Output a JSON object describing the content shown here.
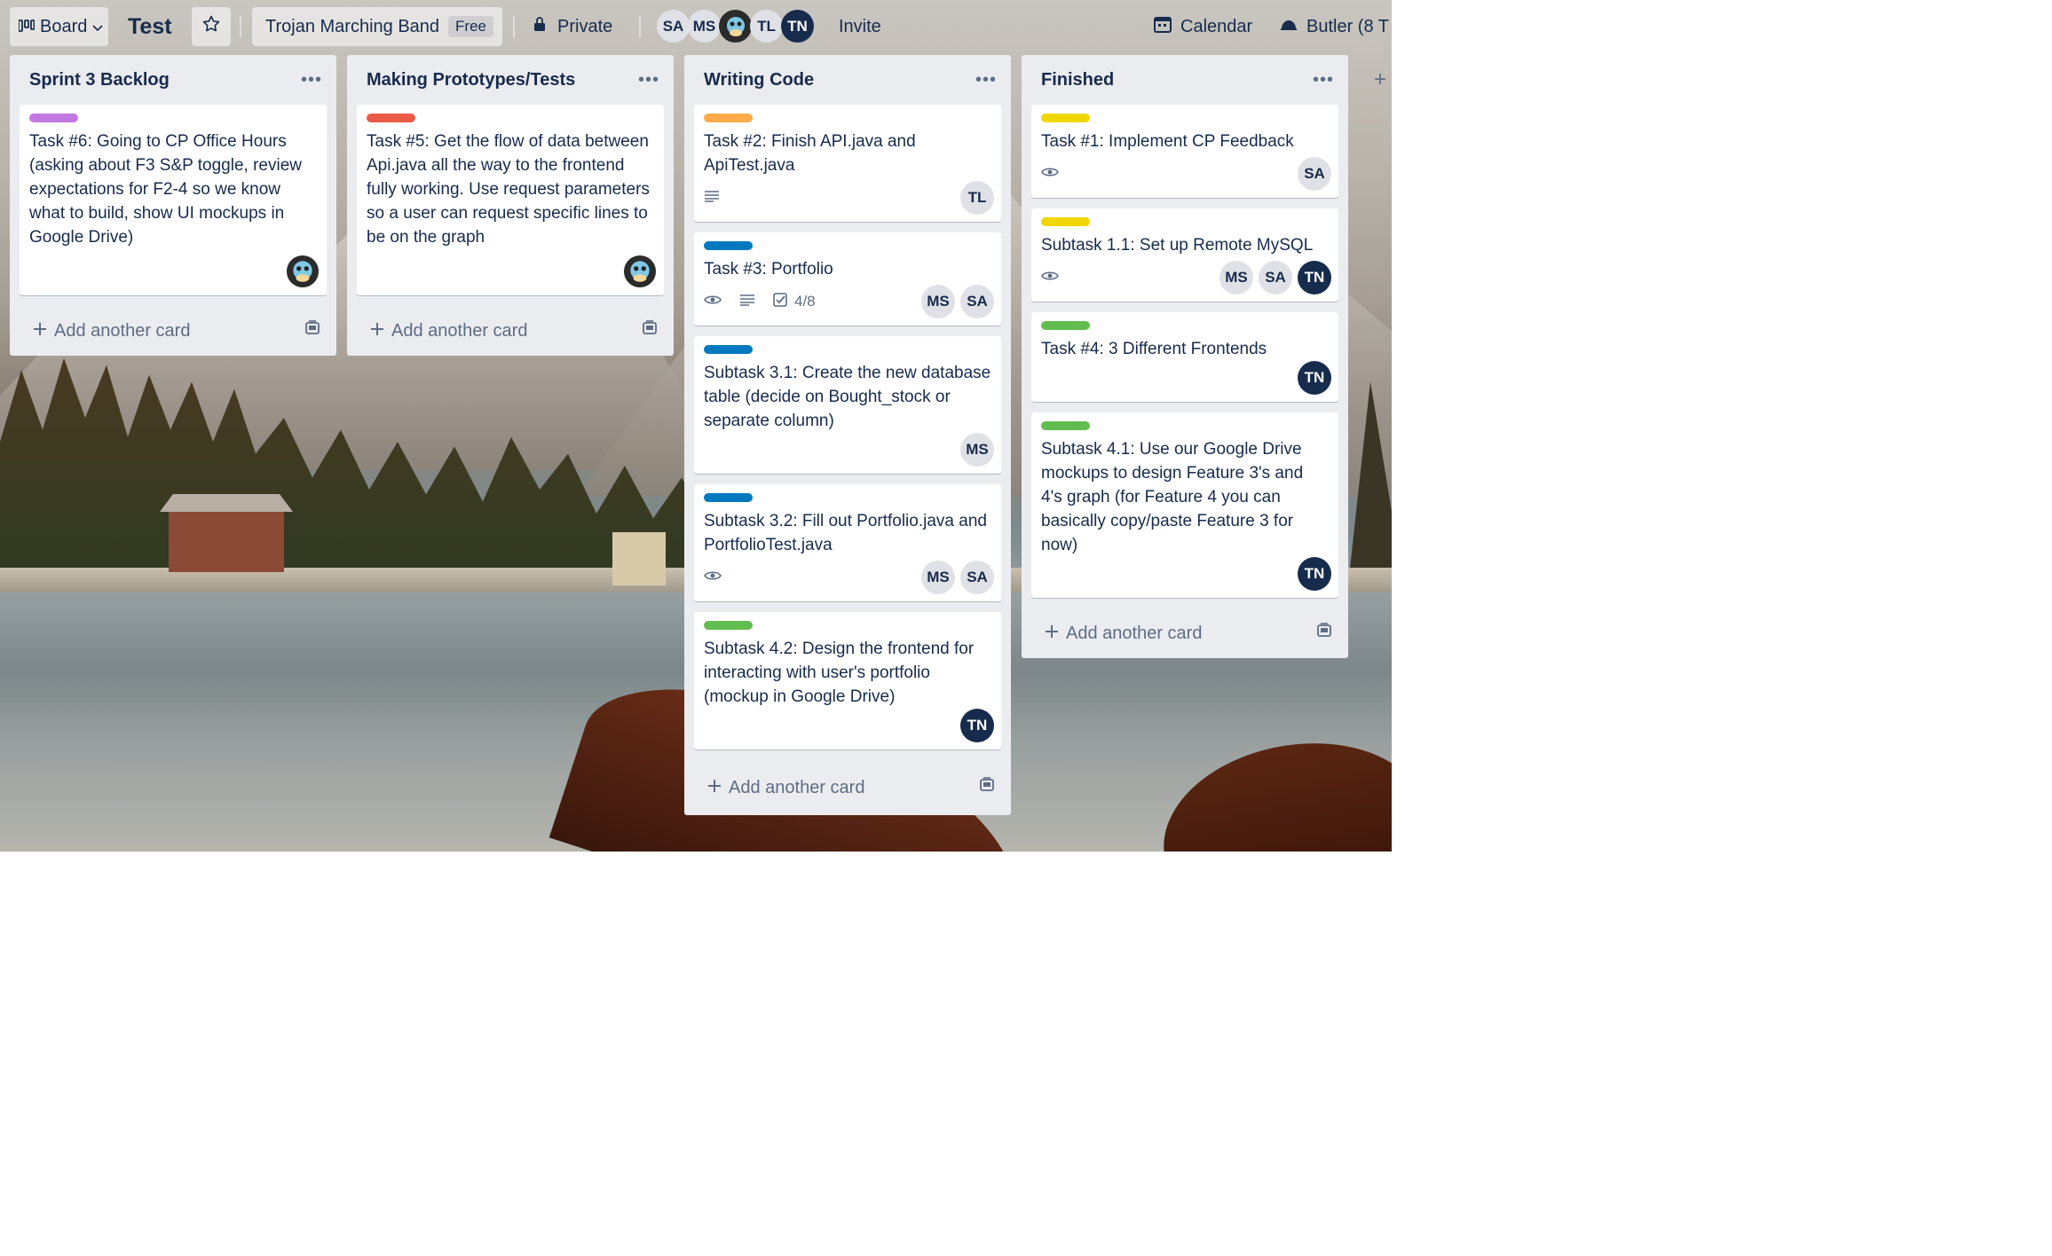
{
  "header": {
    "board_view": "Board",
    "board_title": "Test",
    "team": "Trojan Marching Band",
    "team_badge": "Free",
    "visibility": "Private",
    "members": [
      "SA",
      "MS",
      "TL",
      "TN"
    ],
    "invite": "Invite",
    "calendar": "Calendar",
    "butler": "Butler (8 T"
  },
  "lists": [
    {
      "title": "Sprint 3 Backlog",
      "add_label": "Add another card",
      "cards": [
        {
          "label_color": "#c377e0",
          "title": "Task #6: Going to CP Office Hours (asking about F3 S&P toggle, review expectations for F2-4 so we know what to build, show UI mockups in Google Drive)"
        }
      ]
    },
    {
      "title": "Making Prototypes/Tests",
      "add_label": "Add another card",
      "cards": [
        {
          "label_color": "#eb5a46",
          "title": "Task #5: Get the flow of data between Api.java all the way to the frontend fully working. Use request parameters so a user can request specific lines to be on the graph"
        }
      ]
    },
    {
      "title": "Writing Code",
      "add_label": "Add another card",
      "cards": [
        {
          "label_color": "#ffab4a",
          "title": "Task #2: Finish API.java and ApiTest.java",
          "members": [
            "TL"
          ]
        },
        {
          "label_color": "#0079bf",
          "title": "Task #3: Portfolio",
          "checklist": "4/8",
          "members": [
            "MS",
            "SA"
          ]
        },
        {
          "label_color": "#0079bf",
          "title": "Subtask 3.1: Create the new database table (decide on Bought_stock or separate column)",
          "members": [
            "MS"
          ]
        },
        {
          "label_color": "#0079bf",
          "title": "Subtask 3.2: Fill out Portfolio.java and PortfolioTest.java",
          "members": [
            "MS",
            "SA"
          ]
        },
        {
          "label_color": "#61bd4f",
          "title": "Subtask 4.2: Design the frontend for interacting with user's portfolio (mockup in Google Drive)",
          "members": [
            "TN"
          ]
        }
      ]
    },
    {
      "title": "Finished",
      "add_label": "Add another card",
      "cards": [
        {
          "label_color": "#f2d600",
          "title": "Task #1: Implement CP Feedback",
          "members": [
            "SA"
          ]
        },
        {
          "label_color": "#f2d600",
          "title": "Subtask 1.1: Set up Remote MySQL",
          "members": [
            "MS",
            "SA",
            "TN"
          ]
        },
        {
          "label_color": "#61bd4f",
          "title": "Task #4: 3 Different Frontends",
          "members": [
            "TN"
          ]
        },
        {
          "label_color": "#61bd4f",
          "title": "Subtask 4.1: Use our Google Drive mockups to design Feature 3's and 4's graph (for Feature 4 you can basically copy/paste Feature 3 for now)",
          "members": [
            "TN"
          ]
        }
      ]
    }
  ]
}
